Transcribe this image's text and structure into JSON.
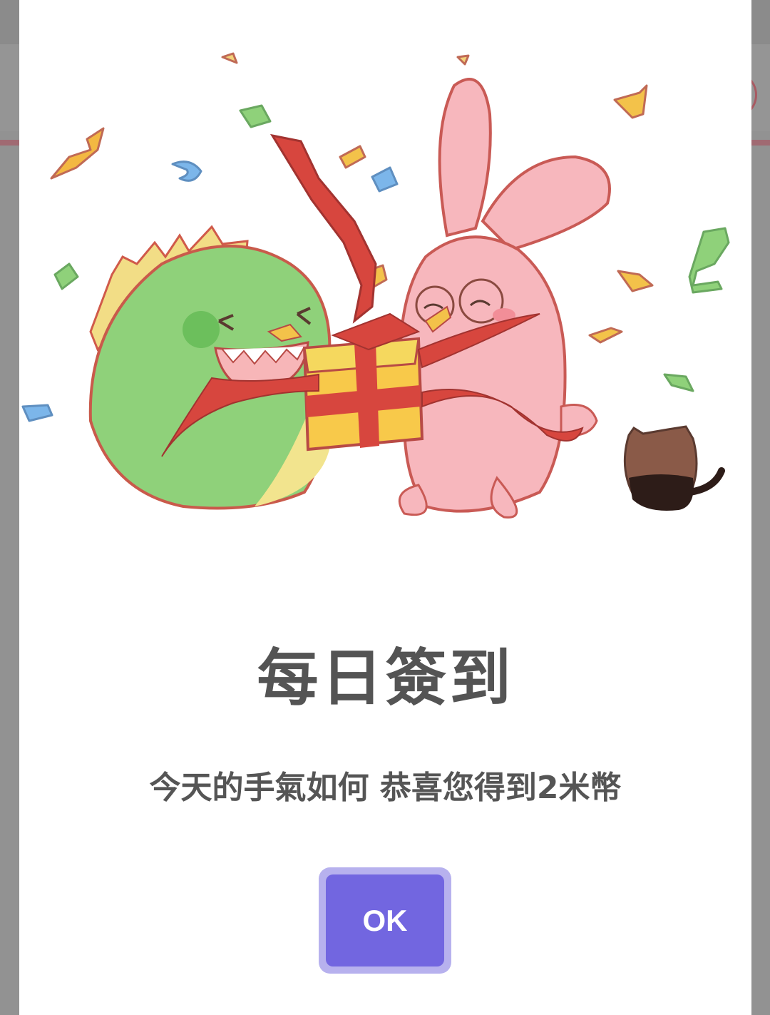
{
  "dialog": {
    "title": "每日簽到",
    "message": "今天的手氣如何 恭喜您得到2米幣",
    "ok_label": "OK",
    "illustration": "celebration-dino-bunny-gift"
  },
  "colors": {
    "accent": "#7266e0",
    "accent_ring": "#b7b1ee",
    "text": "#555555",
    "overlay": "#929292"
  }
}
